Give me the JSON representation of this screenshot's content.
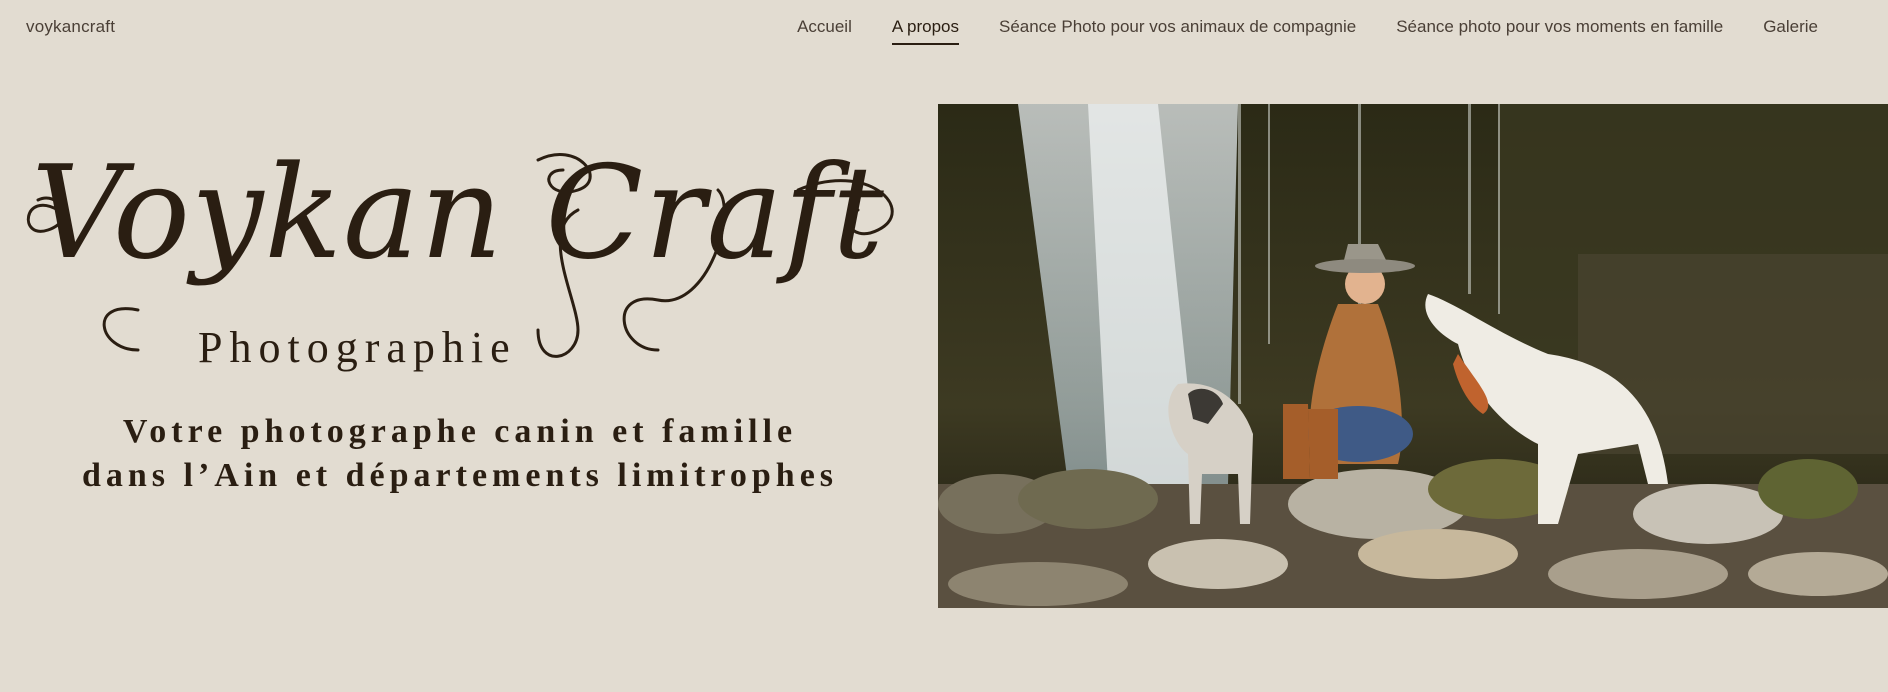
{
  "header": {
    "site_title": "voykancraft",
    "nav": [
      {
        "label": "Accueil",
        "active": false
      },
      {
        "label": "A propos",
        "active": true
      },
      {
        "label": "Séance Photo pour vos animaux de compagnie",
        "active": false
      },
      {
        "label": "Séance photo pour vos moments en famille",
        "active": false
      },
      {
        "label": "Galerie",
        "active": false
      }
    ]
  },
  "hero": {
    "logo_text": "Voykan Craft",
    "logo_subtitle": "Photographie",
    "tagline_line1": "Votre photographe canin et famille",
    "tagline_line2": "dans l’Ain et départements limitrophes"
  },
  "colors": {
    "background": "#e2dcd1",
    "text_dark": "#2a1e12",
    "nav_text": "#4a3f36"
  }
}
